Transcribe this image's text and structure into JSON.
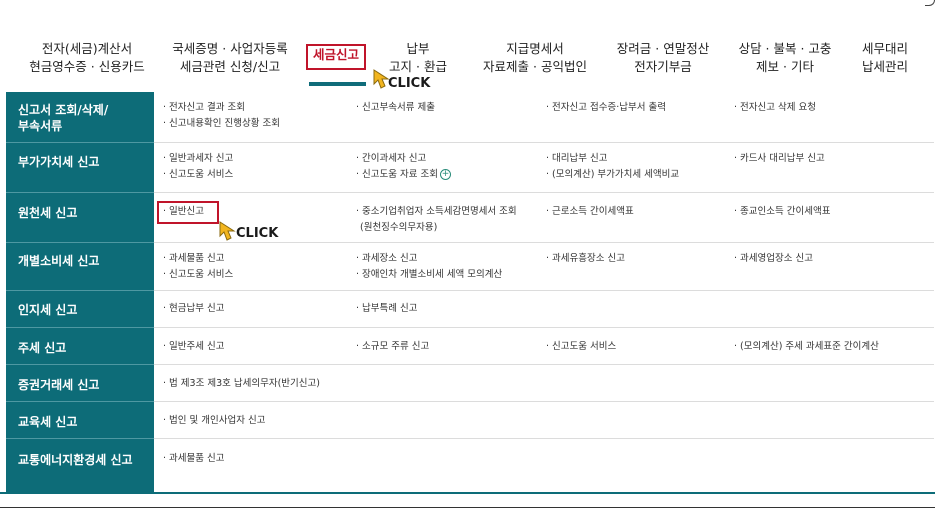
{
  "nav": {
    "items": [
      {
        "line1": "전자(세금)계산서",
        "line2": "현금영수증 · 신용카드"
      },
      {
        "line1": "국세증명 · 사업자등록",
        "line2": "세금관련 신청/신고"
      },
      {
        "line1": "세금신고",
        "line2": ""
      },
      {
        "line1": "납부",
        "line2": "고지 · 환급"
      },
      {
        "line1": "지급명세서",
        "line2": "자료제출 · 공익법인"
      },
      {
        "line1": "장려금 · 연말정산",
        "line2": "전자기부금"
      },
      {
        "line1": "상담 · 불복 · 고충",
        "line2": "제보 · 기타"
      },
      {
        "line1": "세무대리",
        "line2": "납세관리"
      }
    ],
    "active_index": 2
  },
  "annotations": {
    "click_label": "CLICK",
    "accent_color": "#c0142a",
    "cursor_color": "#f2b51f"
  },
  "sidebar": {
    "color": "#0d6c78",
    "items": [
      {
        "line1": "신고서 조회/삭제/",
        "line2": "부속서류"
      },
      {
        "line1": "부가가치세 신고",
        "line2": ""
      },
      {
        "line1": "원천세 신고",
        "line2": ""
      },
      {
        "line1": "개별소비세 신고",
        "line2": ""
      },
      {
        "line1": "인지세 신고",
        "line2": ""
      },
      {
        "line1": "주세 신고",
        "line2": ""
      },
      {
        "line1": "증권거래세 신고",
        "line2": ""
      },
      {
        "line1": "교육세 신고",
        "line2": ""
      },
      {
        "line1": "교통에너지환경세 신고",
        "line2": ""
      }
    ]
  },
  "rows": [
    {
      "c1": [
        "· 전자신고 결과 조회",
        "· 신고내용확인 진행상황 조회"
      ],
      "c2": [
        "· 신고부속서류 제출"
      ],
      "c3": [
        "· 전자신고 접수증·납부서 출력"
      ],
      "c4": [
        "· 전자신고 삭제 요청"
      ]
    },
    {
      "c1": [
        "· 일반과세자 신고",
        "· 신고도움 서비스"
      ],
      "c2": [
        "· 간이과세자 신고",
        "· 신고도움 자료 조회"
      ],
      "c3": [
        "· 대리납부 신고",
        "· (모의계산) 부가가치세 세액비교"
      ],
      "c4": [
        "· 카드사 대리납부 신고"
      ]
    },
    {
      "c1": [
        "· 일반신고"
      ],
      "c2": [
        "· 중소기업취업자 소득세감면명세서 조회",
        "(원천징수의무자용)"
      ],
      "c3": [
        "· 근로소득 간이세액표"
      ],
      "c4": [
        "· 종교인소득 간이세액표"
      ]
    },
    {
      "c1": [
        "· 과세물품 신고",
        "· 신고도움 서비스"
      ],
      "c2": [
        "· 과세장소 신고",
        "· 장애인차 개별소비세 세액 모의계산"
      ],
      "c3": [
        "· 과세유흥장소 신고"
      ],
      "c4": [
        "· 과세영업장소 신고"
      ]
    },
    {
      "c1": [
        "· 현금납부 신고"
      ],
      "c2": [
        "· 납부특례 신고"
      ],
      "c3": [],
      "c4": []
    },
    {
      "c1": [
        "· 일반주세 신고"
      ],
      "c2": [
        "· 소규모 주류 신고"
      ],
      "c3": [
        "· 신고도움 서비스"
      ],
      "c4": [
        "· (모의계산) 주세 과세표준 간이계산"
      ]
    },
    {
      "c1": [
        "· 법 제3조 제3호 납세의무자(반기신고)"
      ],
      "c2": [],
      "c3": [],
      "c4": []
    },
    {
      "c1": [
        "· 법인 및 개인사업자 신고"
      ],
      "c2": [],
      "c3": [],
      "c4": []
    },
    {
      "c1": [
        "· 과세물품 신고"
      ],
      "c2": [],
      "c3": [],
      "c4": []
    }
  ]
}
